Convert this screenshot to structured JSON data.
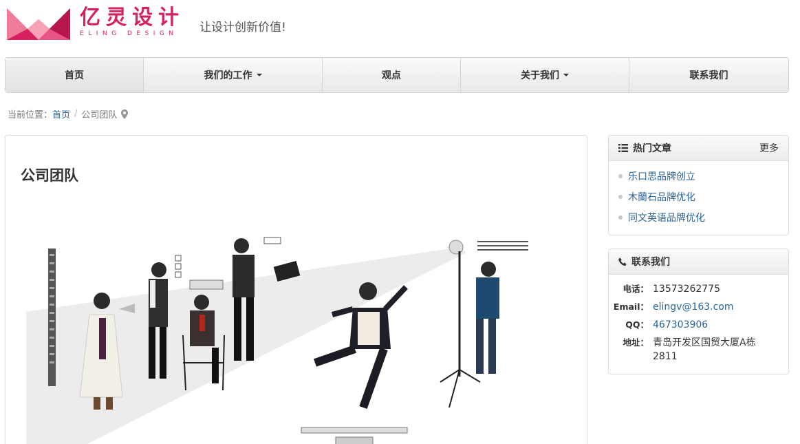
{
  "brand": {
    "name_cn": "亿灵设计",
    "name_en": "ELING DESIGN",
    "slogan": "让设计创新价值!",
    "color": "#d6205f"
  },
  "nav": {
    "items": [
      {
        "label": "首页",
        "dropdown": false,
        "active": true
      },
      {
        "label": "我们的工作",
        "dropdown": true
      },
      {
        "label": "观点",
        "dropdown": false
      },
      {
        "label": "关于我们",
        "dropdown": true
      },
      {
        "label": "联系我们",
        "dropdown": false
      }
    ]
  },
  "breadcrumb": {
    "prefix": "当前位置：",
    "home": "首页",
    "separator": "/",
    "current": "公司团队",
    "icon": "map-marker-icon"
  },
  "main": {
    "title": "公司团队"
  },
  "hot_articles": {
    "icon": "list-icon",
    "title": "热门文章",
    "more": "更多",
    "items": [
      "乐口思品牌创立",
      "木蘭石品牌优化",
      "同文英语品牌优化"
    ]
  },
  "contact": {
    "icon": "phone-icon",
    "title": "联系我们",
    "rows": [
      {
        "label": "电话：",
        "value": "13573262775"
      },
      {
        "label": "Email：",
        "value": "elingv@163.com"
      },
      {
        "label": "QQ：",
        "value": "467303906"
      },
      {
        "label": "地址：",
        "value": "青岛开发区国贸大厦A栋2811"
      }
    ]
  },
  "colors": {
    "link": "#2a6496",
    "brand": "#d6205f"
  }
}
